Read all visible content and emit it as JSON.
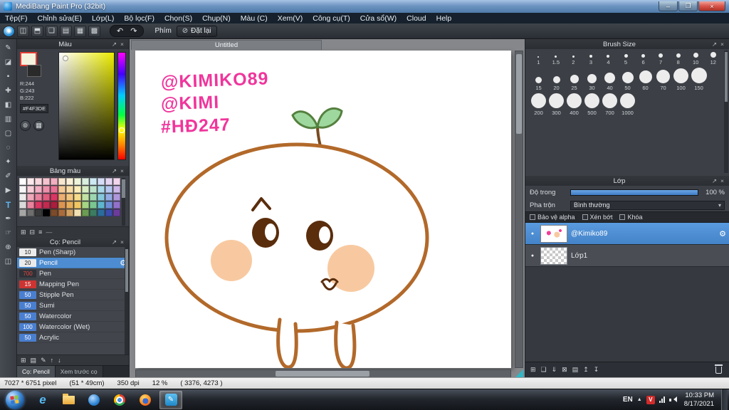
{
  "titlebar": {
    "title": "MediBang Paint Pro (32bit)"
  },
  "menubar": {
    "items": [
      "Tệp(F)",
      "Chỉnh sửa(E)",
      "Lớp(L)",
      "Bộ lọc(F)",
      "Chọn(S)",
      "Chụp(N)",
      "Màu (C)",
      "Xem(V)",
      "Công cụ(T)",
      "Cửa sổ(W)",
      "Cloud",
      "Help"
    ]
  },
  "icons": {
    "undo": "↶",
    "redo": "↷",
    "block": "⊘",
    "close": "×",
    "popout": "↗",
    "chevron_down": "▾",
    "gear": "⚙",
    "eye": "●",
    "tray_arrow": "▲",
    "minimize": "–",
    "maximize": "❐",
    "wheel": "⊚",
    "grid": "▦",
    "dash": "—"
  },
  "tools": [
    {
      "name": "brush",
      "glyph": "✎"
    },
    {
      "name": "eraser",
      "glyph": "◪"
    },
    {
      "name": "dot",
      "glyph": "▪"
    },
    {
      "name": "move",
      "glyph": "✚"
    },
    {
      "name": "fill",
      "glyph": "◧"
    },
    {
      "name": "gradient",
      "glyph": "▥"
    },
    {
      "name": "select",
      "glyph": "▢"
    },
    {
      "name": "lasso",
      "glyph": "◌"
    },
    {
      "name": "magic-wand",
      "glyph": "✦"
    },
    {
      "name": "select-pen",
      "glyph": "✐"
    },
    {
      "name": "operation",
      "glyph": "▶"
    },
    {
      "name": "text",
      "glyph": "T"
    },
    {
      "name": "eyedropper",
      "glyph": "✒"
    },
    {
      "name": "hand",
      "glyph": "☞"
    },
    {
      "name": "zoom",
      "glyph": "⊕"
    },
    {
      "name": "panel-divide",
      "glyph": "◫"
    }
  ],
  "toolbar": {
    "icons": [
      {
        "name": "cloud",
        "glyph": "◉"
      },
      {
        "name": "save",
        "glyph": "◫"
      },
      {
        "name": "upload",
        "glyph": "⬒"
      },
      {
        "name": "comment",
        "glyph": "❏"
      },
      {
        "name": "document",
        "glyph": "▤"
      },
      {
        "name": "grid",
        "glyph": "▦"
      },
      {
        "name": "material",
        "glyph": "▩"
      }
    ],
    "shortcut_label": "Phím",
    "reset_button": "Đặt lại"
  },
  "panels": {
    "color": {
      "title": "Màu",
      "r": "R:244",
      "g": "G:243",
      "b": "B:222",
      "hex": "#F4F3DE"
    },
    "palette": {
      "title": "Bảng màu",
      "toolbar_icons": [
        {
          "name": "new-color",
          "glyph": "⊞"
        },
        {
          "name": "delete-color",
          "glyph": "⊟"
        },
        {
          "name": "palette-menu",
          "glyph": "≡"
        }
      ],
      "colors": [
        "#ffffff",
        "#fbe9ec",
        "#f8d7de",
        "#f4c3cf",
        "#f1afc0",
        "#f8e6cf",
        "#fbf1d8",
        "#eef5da",
        "#dbefe0",
        "#cdeaf2",
        "#d5dcf5",
        "#e4d6f2",
        "#f2d6ec",
        "#f7f7f7",
        "#f7cdd8",
        "#f2aec2",
        "#ec8fab",
        "#e77094",
        "#f4c996",
        "#f8dca6",
        "#fbeeba",
        "#d8ecc4",
        "#bde3cb",
        "#a9d8e8",
        "#b4c6ee",
        "#cdb7e8",
        "#ededed",
        "#f0a8ba",
        "#e9829d",
        "#e25c80",
        "#db3663",
        "#edae72",
        "#f2c57e",
        "#f6dc8b",
        "#c2e2a4",
        "#9ed6b0",
        "#86c8dc",
        "#92abe2",
        "#b096da",
        "#d9d9d9",
        "#e9829d",
        "#db3663",
        "#c32a50",
        "#ab1e3d",
        "#dc9452",
        "#e6ad5a",
        "#efc662",
        "#a6d584",
        "#7ac690",
        "#5eb5ce",
        "#6e8dd6",
        "#9271ca",
        "#a6a6a6",
        "#6e6e6e",
        "#3a3a3a",
        "#000000",
        "#7c4b2a",
        "#aa6c3c",
        "#d2a262",
        "#f2e2b2",
        "#6c9c52",
        "#3c7c62",
        "#2c6c9c",
        "#3c4cac",
        "#6c3c9c"
      ]
    },
    "brush": {
      "title": "Cọ: Pencil",
      "items": [
        {
          "size": "10",
          "name": "Pen (Sharp)"
        },
        {
          "size": "20",
          "name": "Pencil"
        },
        {
          "size": "700",
          "name": "Pen"
        },
        {
          "size": "15",
          "name": "Mapping Pen"
        },
        {
          "size": "50",
          "name": "Stipple Pen"
        },
        {
          "size": "50",
          "name": "Sumi"
        },
        {
          "size": "50",
          "name": "Watercolor"
        },
        {
          "size": "100",
          "name": "Watercolor (Wet)"
        },
        {
          "size": "50",
          "name": "Acrylic"
        }
      ],
      "toolbar_icons": [
        {
          "name": "add-brush",
          "glyph": "⊞"
        },
        {
          "name": "brush-folder",
          "glyph": "▤"
        },
        {
          "name": "edit-brush",
          "glyph": "✎"
        },
        {
          "name": "brush-up",
          "glyph": "↑"
        },
        {
          "name": "brush-down",
          "glyph": "↓"
        }
      ],
      "footer_tabs": [
        "Cọ: Pencil",
        "Xem trước cọ"
      ]
    },
    "brush_size": {
      "title": "Brush Size",
      "rows": [
        [
          "1",
          "1.5",
          "2",
          "3",
          "4",
          "5",
          "6",
          "7",
          "8",
          "10",
          "12"
        ],
        [
          "15",
          "20",
          "25",
          "30",
          "40",
          "50",
          "60",
          "70",
          "100",
          "150"
        ],
        [
          "200",
          "300",
          "400",
          "500",
          "700",
          "1000"
        ]
      ]
    },
    "layer": {
      "title": "Lớp",
      "opacity_label": "Độ trong",
      "opacity_value": "100 %",
      "blend_label": "Pha trộn",
      "blend_value": "Bình thường",
      "alpha_lock_label": "Bảo vệ alpha",
      "clip_label": "Xén bớt",
      "lock_label": "Khóa",
      "layers": [
        {
          "name": "@Kimiko89"
        },
        {
          "name": "Lớp1"
        }
      ],
      "toolbar_icons": [
        {
          "name": "new-layer",
          "glyph": "⊞"
        },
        {
          "name": "duplicate-layer",
          "glyph": "❏"
        },
        {
          "name": "merge-down",
          "glyph": "⇓"
        },
        {
          "name": "clear-layer",
          "glyph": "⊠"
        },
        {
          "name": "layer-folder",
          "glyph": "▤"
        },
        {
          "name": "layer-up",
          "glyph": "↥"
        },
        {
          "name": "layer-down",
          "glyph": "↧"
        }
      ]
    }
  },
  "canvas": {
    "tab": "Untitled",
    "annotations": [
      "@KIMIKO89",
      "@KIMI",
      "#HĐ247"
    ],
    "accent_pink": "#f0359c",
    "outline_brown": "#b2692a"
  },
  "statusbar": {
    "size": "7027 * 6751 pixel",
    "cm": "(51 * 49cm)",
    "dpi": "350 dpi",
    "zoom": "12 %",
    "coords": "( 3376, 4273 )"
  },
  "taskbar": {
    "language": "EN",
    "unikey_label": "V",
    "time": "10:33 PM",
    "date": "8/17/2021"
  }
}
